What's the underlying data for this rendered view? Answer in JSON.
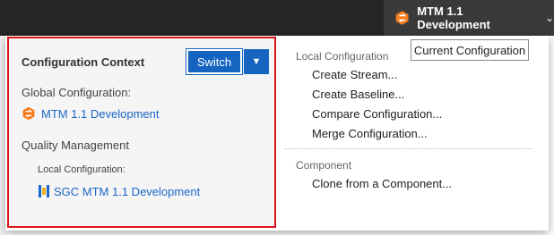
{
  "topbar": {
    "config_name": "MTM 1.1 Development",
    "chevron": "chevron-down-icon",
    "icon": "configuration-badge-icon",
    "icon_color": "#f57c1f",
    "background": "#262626"
  },
  "tooltip": {
    "text": "Current Configuration"
  },
  "context_panel": {
    "title": "Configuration Context",
    "switch_label": "Switch",
    "switch_menu_icon": "chevron-down-icon",
    "accent": "#1565c0",
    "highlight_border": "#d9141b",
    "global_label": "Global Configuration:",
    "global_value": "MTM 1.1 Development",
    "quality_label": "Quality Management",
    "local_label": "Local Configuration:",
    "local_value": "SGC MTM 1.1 Development"
  },
  "menu": {
    "local_header": "Local Configuration",
    "local_items": [
      "Create Stream...",
      "Create Baseline...",
      "Compare Configuration...",
      "Merge Configuration..."
    ],
    "component_header": "Component",
    "component_items": [
      "Clone from a Component..."
    ]
  }
}
